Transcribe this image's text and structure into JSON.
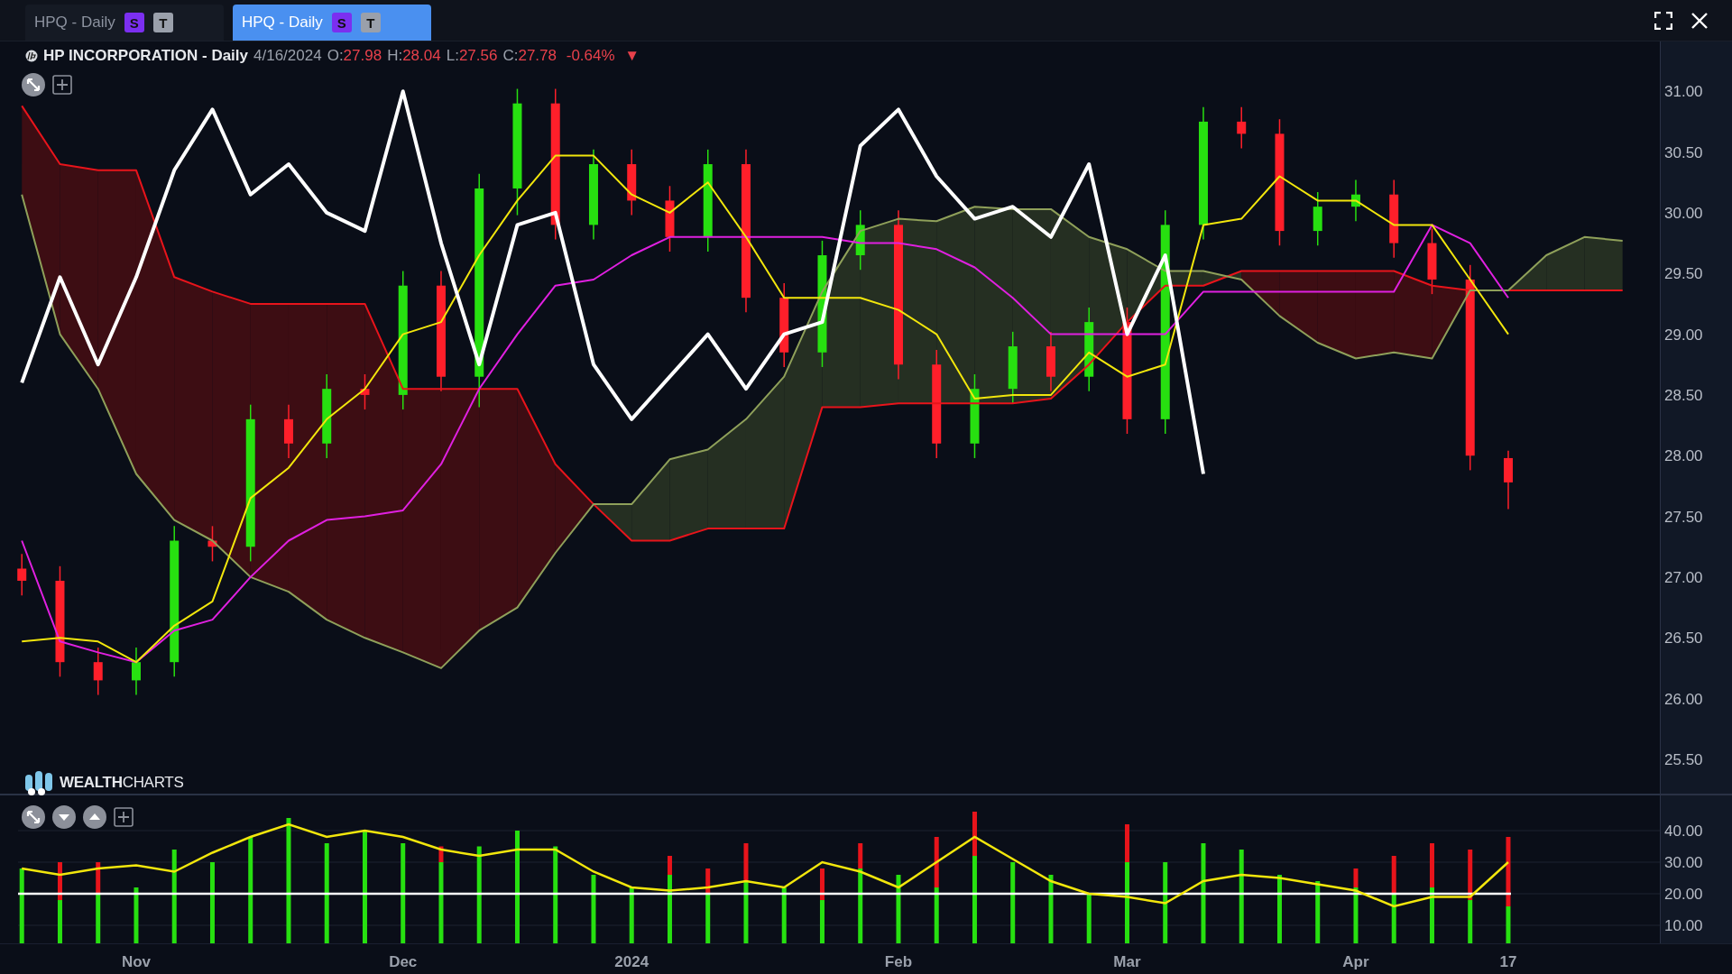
{
  "tabs": [
    {
      "label": "HPQ - Daily",
      "selected": false,
      "badges": [
        {
          "text": "S",
          "color": "#7b2ff0"
        },
        {
          "text": "T",
          "color": "#9aa0ab"
        }
      ]
    },
    {
      "label": "HPQ - Daily",
      "selected": true,
      "badges": [
        {
          "text": "S",
          "color": "#7b2ff0"
        },
        {
          "text": "T",
          "color": "#9aa0ab"
        }
      ]
    }
  ],
  "header": {
    "title": "HP INCORPORATION - Daily",
    "date": "4/16/2024",
    "fields": [
      {
        "label": "O:",
        "value": "27.98"
      },
      {
        "label": "H:",
        "value": "28.04"
      },
      {
        "label": "L:",
        "value": "27.56"
      },
      {
        "label": "C:",
        "value": "27.78"
      }
    ],
    "change": "-0.64%",
    "arrow": "▼"
  },
  "price_chart": {
    "chart_data": {
      "type": "candlestick",
      "ylim": [
        25.21,
        31.41
      ],
      "categories": [
        null,
        null,
        null,
        null,
        null,
        null,
        null,
        null,
        null,
        null,
        null,
        null,
        null,
        null,
        null,
        null,
        null,
        null,
        null,
        null,
        null,
        null,
        null,
        null,
        null,
        null,
        null,
        null,
        null,
        null,
        null,
        null,
        null,
        null,
        null,
        null,
        null,
        null,
        null,
        null,
        null,
        null,
        null
      ],
      "yticks": [
        {
          "value": 31,
          "label": "31.00"
        },
        {
          "value": 30.5,
          "label": "30.50"
        },
        {
          "value": 30,
          "label": "30.00"
        },
        {
          "value": 29.5,
          "label": "29.50"
        },
        {
          "value": 29,
          "label": "29.00"
        },
        {
          "value": 28.5,
          "label": "28.50"
        },
        {
          "value": 28,
          "label": "28.00"
        },
        {
          "value": 27.5,
          "label": "27.50"
        },
        {
          "value": 27,
          "label": "27.00"
        },
        {
          "value": 26.5,
          "label": "26.50"
        },
        {
          "value": 26,
          "label": "26.00"
        },
        {
          "value": 25.5,
          "label": "25.50"
        }
      ],
      "ohlc": [
        [
          27.07,
          27.19,
          26.85,
          26.97
        ],
        [
          26.97,
          27.09,
          26.18,
          26.3
        ],
        [
          26.3,
          26.42,
          26.03,
          26.15
        ],
        [
          26.15,
          26.42,
          26.03,
          26.3
        ],
        [
          26.3,
          27.42,
          26.18,
          27.3
        ],
        [
          27.3,
          27.42,
          27.13,
          27.25
        ],
        [
          27.25,
          28.42,
          27.13,
          28.3
        ],
        [
          28.3,
          28.42,
          27.98,
          28.1
        ],
        [
          28.1,
          28.67,
          27.98,
          28.55
        ],
        [
          28.55,
          28.67,
          28.38,
          28.5
        ],
        [
          28.5,
          29.52,
          28.38,
          29.4
        ],
        [
          29.4,
          29.52,
          28.53,
          28.65
        ],
        [
          28.65,
          30.32,
          28.4,
          30.2
        ],
        [
          30.2,
          31.02,
          29.98,
          30.9
        ],
        [
          30.9,
          31.02,
          29.78,
          29.9
        ],
        [
          29.9,
          30.52,
          29.78,
          30.4
        ],
        [
          30.4,
          30.52,
          29.98,
          30.1
        ],
        [
          30.1,
          30.22,
          29.68,
          29.8
        ],
        [
          29.8,
          30.52,
          29.68,
          30.4
        ],
        [
          30.4,
          30.52,
          29.18,
          29.3
        ],
        [
          29.3,
          29.42,
          28.73,
          28.85
        ],
        [
          28.85,
          29.77,
          28.73,
          29.65
        ],
        [
          29.65,
          30.02,
          29.53,
          29.9
        ],
        [
          29.9,
          30.02,
          28.63,
          28.75
        ],
        [
          28.75,
          28.87,
          27.98,
          28.1
        ],
        [
          28.1,
          28.67,
          27.98,
          28.55
        ],
        [
          28.55,
          29.02,
          28.43,
          28.9
        ],
        [
          28.9,
          29.02,
          28.53,
          28.65
        ],
        [
          28.65,
          29.22,
          28.53,
          29.1
        ],
        [
          29.1,
          29.22,
          28.18,
          28.3
        ],
        [
          28.3,
          30.02,
          28.18,
          29.9
        ],
        [
          29.9,
          30.87,
          29.78,
          30.75
        ],
        [
          30.75,
          30.87,
          30.53,
          30.65
        ],
        [
          30.65,
          30.77,
          29.73,
          29.85
        ],
        [
          29.85,
          30.17,
          29.73,
          30.05
        ],
        [
          30.05,
          30.27,
          29.93,
          30.15
        ],
        [
          30.15,
          30.27,
          29.63,
          29.75
        ],
        [
          29.75,
          29.87,
          29.33,
          29.45
        ],
        [
          29.45,
          29.57,
          27.88,
          28.0
        ],
        [
          27.98,
          28.04,
          27.56,
          27.78
        ],
        null,
        null,
        null
      ],
      "series": [
        {
          "type": "line",
          "color": "#e8141b",
          "values": [
            30.88,
            30.4,
            30.35,
            30.35,
            29.47,
            29.35,
            29.25,
            29.25,
            29.25,
            29.25,
            28.55,
            28.55,
            28.55,
            28.55,
            27.93,
            27.6,
            27.3,
            27.3,
            27.4,
            27.4,
            27.4,
            28.4,
            28.4,
            28.43,
            28.43,
            28.43,
            28.43,
            28.47,
            28.75,
            29.1,
            29.4,
            29.4,
            29.52,
            29.52,
            29.52,
            29.52,
            29.52,
            29.4,
            29.36,
            29.36,
            29.36,
            29.36,
            29.36
          ]
        },
        {
          "type": "line",
          "color": "#8fa05a",
          "values": [
            30.15,
            29.0,
            28.55,
            27.85,
            27.47,
            27.3,
            27.0,
            26.88,
            26.65,
            26.5,
            26.38,
            26.25,
            26.56,
            26.75,
            27.2,
            27.6,
            27.6,
            27.97,
            28.05,
            28.3,
            28.65,
            29.35,
            29.85,
            29.95,
            29.93,
            30.05,
            30.03,
            30.03,
            29.8,
            29.7,
            29.52,
            29.52,
            29.45,
            29.15,
            28.93,
            28.8,
            28.85,
            28.8,
            29.36,
            29.36,
            29.65,
            29.8,
            29.77
          ]
        },
        {
          "type": "line",
          "color": "#e020e0",
          "values": [
            27.3,
            26.47,
            26.38,
            26.3,
            26.56,
            26.65,
            27.0,
            27.3,
            27.47,
            27.5,
            27.55,
            27.93,
            28.55,
            29.0,
            29.4,
            29.45,
            29.65,
            29.8,
            29.8,
            29.8,
            29.8,
            29.8,
            29.75,
            29.75,
            29.7,
            29.55,
            29.3,
            29.0,
            29.0,
            29.0,
            29.0,
            29.35,
            29.35,
            29.35,
            29.35,
            29.35,
            29.35,
            29.9,
            29.75,
            29.3,
            null,
            null,
            null
          ]
        },
        {
          "type": "line",
          "color": "#f2e60c",
          "values": [
            26.47,
            26.5,
            26.47,
            26.3,
            26.6,
            26.8,
            27.65,
            27.9,
            28.3,
            28.55,
            29.0,
            29.1,
            29.65,
            30.1,
            30.47,
            30.47,
            30.15,
            30.0,
            30.25,
            29.8,
            29.3,
            29.3,
            29.3,
            29.2,
            29.0,
            28.47,
            28.5,
            28.5,
            28.85,
            28.65,
            28.75,
            29.9,
            29.95,
            30.3,
            30.1,
            30.1,
            29.9,
            29.9,
            29.45,
            29.0,
            null,
            null,
            null
          ]
        },
        {
          "type": "line",
          "color": "#ffffff",
          "values": [
            28.6,
            29.47,
            28.75,
            29.47,
            30.35,
            30.85,
            30.15,
            30.4,
            30.0,
            29.85,
            31.0,
            29.75,
            28.75,
            29.9,
            30.0,
            28.75,
            28.3,
            28.65,
            29.0,
            28.55,
            29.0,
            29.1,
            30.55,
            30.85,
            30.3,
            29.95,
            30.05,
            29.8,
            30.4,
            29.0,
            29.65,
            27.85,
            null,
            null,
            null,
            null,
            null,
            null,
            null,
            null,
            null,
            null,
            null
          ]
        }
      ]
    }
  },
  "logo": {
    "text": "**WEALTH**CHARTS"
  },
  "volume_chart": {
    "chart_data": {
      "type": "bar",
      "stacked": true,
      "grid": true,
      "ylim": [
        4.29,
        51.43
      ],
      "categories": [
        null,
        null,
        null,
        "Nov",
        null,
        null,
        null,
        null,
        null,
        null,
        "Dec",
        null,
        null,
        null,
        null,
        null,
        "2024",
        null,
        null,
        null,
        null,
        null,
        null,
        "Feb",
        null,
        null,
        null,
        null,
        null,
        "Mar",
        null,
        null,
        null,
        null,
        null,
        "Apr",
        null,
        null,
        null,
        "17"
      ],
      "yticks": [
        {
          "value": 40,
          "label": "40.00"
        },
        {
          "value": 30,
          "label": "30.00"
        },
        {
          "value": 20,
          "label": "20.00"
        },
        {
          "value": 10,
          "label": "10.00"
        }
      ],
      "ref_lines": [
        {
          "axis": "y",
          "value": 20
        }
      ],
      "series": [
        {
          "type": "bar",
          "color": "#27e010",
          "values": [
            28,
            18,
            20,
            22,
            34,
            30,
            38,
            44,
            36,
            40,
            36,
            30,
            35,
            40,
            35,
            26,
            22,
            26,
            20,
            24,
            22,
            18,
            28,
            26,
            22,
            32,
            30,
            26,
            20,
            30,
            30,
            36,
            34,
            26,
            24,
            22,
            20,
            22,
            18,
            16
          ]
        },
        {
          "type": "bar",
          "color": "#e8141b",
          "values": [
            null,
            12,
            10,
            null,
            null,
            null,
            null,
            null,
            null,
            null,
            null,
            5,
            null,
            null,
            null,
            null,
            null,
            6,
            8,
            12,
            null,
            10,
            8,
            null,
            16,
            14,
            null,
            null,
            null,
            12,
            null,
            null,
            null,
            null,
            null,
            6,
            12,
            14,
            16,
            22
          ]
        },
        {
          "type": "line",
          "color": "#f2e60c",
          "values": [
            28,
            26,
            28,
            29,
            27,
            33,
            38,
            42,
            38,
            40,
            38,
            34,
            32,
            34,
            34,
            27,
            22,
            21,
            22,
            24,
            22,
            30,
            27,
            22,
            30,
            38,
            31,
            24,
            20,
            19,
            17,
            24,
            26,
            25,
            23,
            21,
            16,
            19,
            19,
            30
          ]
        }
      ]
    }
  }
}
